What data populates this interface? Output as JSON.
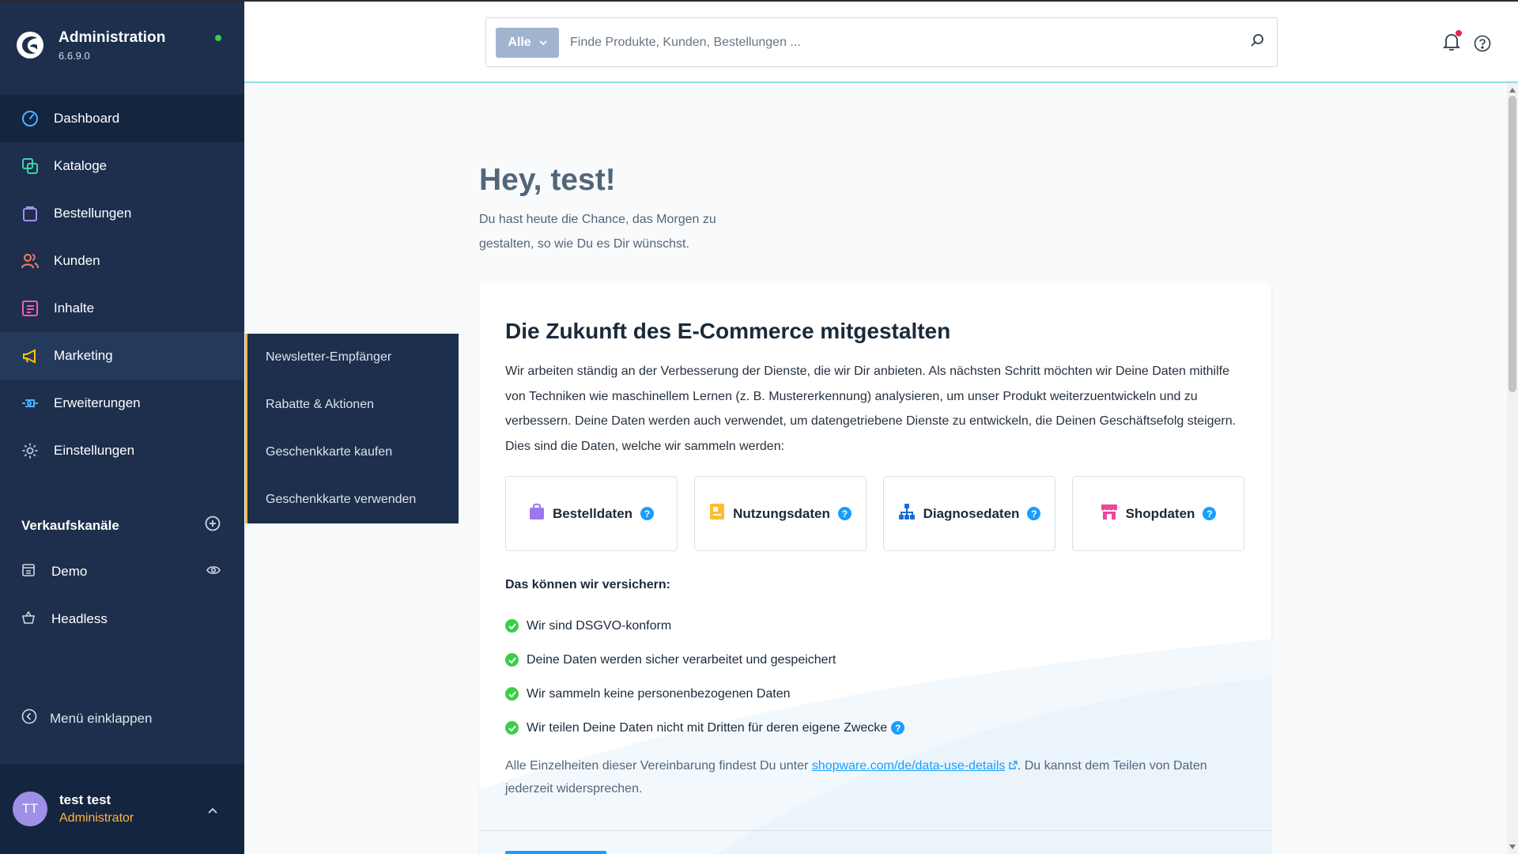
{
  "app": {
    "title": "Administration",
    "version": "6.6.9.0"
  },
  "nav": {
    "items": [
      {
        "label": "Dashboard",
        "icon": "dashboard-icon"
      },
      {
        "label": "Kataloge",
        "icon": "catalog-icon"
      },
      {
        "label": "Bestellungen",
        "icon": "orders-icon"
      },
      {
        "label": "Kunden",
        "icon": "customers-icon"
      },
      {
        "label": "Inhalte",
        "icon": "content-icon"
      },
      {
        "label": "Marketing",
        "icon": "megaphone-icon"
      },
      {
        "label": "Erweiterungen",
        "icon": "extensions-icon"
      },
      {
        "label": "Einstellungen",
        "icon": "gear-icon"
      }
    ],
    "active": "Dashboard",
    "hovered": "Marketing"
  },
  "flyout": {
    "items": [
      "Newsletter-Empfänger",
      "Rabatte & Aktionen",
      "Geschenkkarte kaufen",
      "Geschenkkarte verwenden"
    ]
  },
  "sales_channels": {
    "heading": "Verkaufskanäle",
    "items": [
      {
        "label": "Demo",
        "icon": "storefront-icon"
      },
      {
        "label": "Headless",
        "icon": "basket-icon"
      }
    ]
  },
  "collapse_label": "Menü einklappen",
  "user": {
    "initials": "TT",
    "name": "test test",
    "role": "Administrator"
  },
  "search": {
    "scope": "Alle",
    "placeholder": "Finde Produkte, Kunden, Bestellungen ..."
  },
  "greeting": {
    "title": "Hey, test!",
    "subtitle": "Du hast heute die Chance, das Morgen zu gestalten, so wie Du es Dir wünschst."
  },
  "consent_card": {
    "title": "Die Zukunft des E-Commerce mitgestalten",
    "text": "Wir arbeiten ständig an der Verbesserung der Dienste, die wir Dir anbieten. Als nächsten Schritt möchten wir Deine Daten mithilfe von Techniken wie maschinellem Lernen (z. B. Mustererkennung) analysieren, um unser Produkt weiterzuentwickeln und zu verbessern. Deine Daten werden auch verwendet, um datengetriebene Dienste zu entwickeln, die Deinen Geschäftsefolg steigern. Dies sind die Daten, welche wir sammeln werden:",
    "tiles": [
      {
        "label": "Bestelldaten",
        "icon": "bag-icon",
        "color": "#9e76f2"
      },
      {
        "label": "Nutzungsdaten",
        "icon": "usage-icon",
        "color": "#ffbc2f"
      },
      {
        "label": "Diagnosedaten",
        "icon": "hierarchy-icon",
        "color": "#1b6bd6"
      },
      {
        "label": "Shopdaten",
        "icon": "shop-icon",
        "color": "#f0459b"
      }
    ],
    "assurance_heading": "Das können wir versichern:",
    "assurances": [
      "Wir sind DSGVO-konform",
      "Deine Daten werden sicher verarbeitet und gespeichert",
      "Wir sammeln keine personenbezogenen Daten",
      "Wir teilen Deine Daten nicht mit Dritten für deren eigene Zwecke"
    ],
    "details_prefix": "Alle Einzelheiten dieser Vereinbarung findest Du unter ",
    "details_link": "shopware.com/de/data-use-details",
    "details_suffix": ". Du kannst dem Teilen von Daten jederzeit widersprechen."
  },
  "colors": {
    "sidebar": "#1d2f4d",
    "accent": "#189eff",
    "success": "#37d046",
    "highlight": "#ffb53d"
  }
}
